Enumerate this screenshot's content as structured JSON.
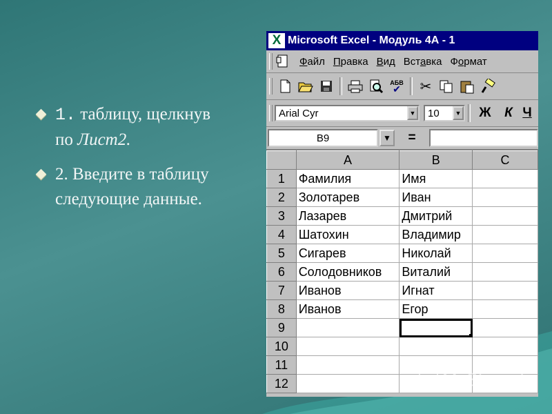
{
  "slide": {
    "bullets": [
      {
        "num": "1.",
        "text": " таблицу, щелкнув",
        "line2_plain": "по ",
        "line2_italic": "Лист2."
      },
      {
        "line1": "2. Введите в таблицу",
        "line2": "следующие данные."
      }
    ],
    "watermark": "MyShared"
  },
  "excel": {
    "title": "Microsoft Excel - Модуль 4А - 1",
    "logo_glyph": "X",
    "menu": [
      {
        "pre": "",
        "u": "Ф",
        "post": "айл"
      },
      {
        "pre": "",
        "u": "П",
        "post": "равка"
      },
      {
        "pre": "",
        "u": "В",
        "post": "ид"
      },
      {
        "pre": "Вст",
        "u": "а",
        "post": "вка"
      },
      {
        "pre": "Ф",
        "u": "о",
        "post": "рмат"
      }
    ],
    "toolbar_icons": [
      "new-icon",
      "open-icon",
      "save-icon",
      "print-icon",
      "preview-icon",
      "spellcheck-icon",
      "cut-icon",
      "copy-icon",
      "paste-icon",
      "format-painter-icon"
    ],
    "font_name": "Arial Cyr",
    "font_size": "10",
    "bold_label": "Ж",
    "italic_label": "К",
    "underline_label": "Ч",
    "name_box": "B9",
    "formula_eq": "=",
    "columns": [
      "A",
      "B",
      "C"
    ],
    "rows": [
      {
        "n": "1",
        "a": "Фамилия",
        "b": "Имя"
      },
      {
        "n": "2",
        "a": "Золотарев",
        "b": "Иван"
      },
      {
        "n": "3",
        "a": "Лазарев",
        "b": "Дмитрий"
      },
      {
        "n": "4",
        "a": "Шатохин",
        "b": "Владимир"
      },
      {
        "n": "5",
        "a": "Сигарев",
        "b": "Николай"
      },
      {
        "n": "6",
        "a": "Солодовников",
        "b": "Виталий"
      },
      {
        "n": "7",
        "a": "Иванов",
        "b": "Игнат"
      },
      {
        "n": "8",
        "a": "Иванов",
        "b": "Егор"
      },
      {
        "n": "9",
        "a": "",
        "b": ""
      },
      {
        "n": "10",
        "a": "",
        "b": ""
      },
      {
        "n": "11",
        "a": "",
        "b": ""
      },
      {
        "n": "12",
        "a": "",
        "b": ""
      }
    ],
    "active_row": "9",
    "active_col": "B"
  }
}
